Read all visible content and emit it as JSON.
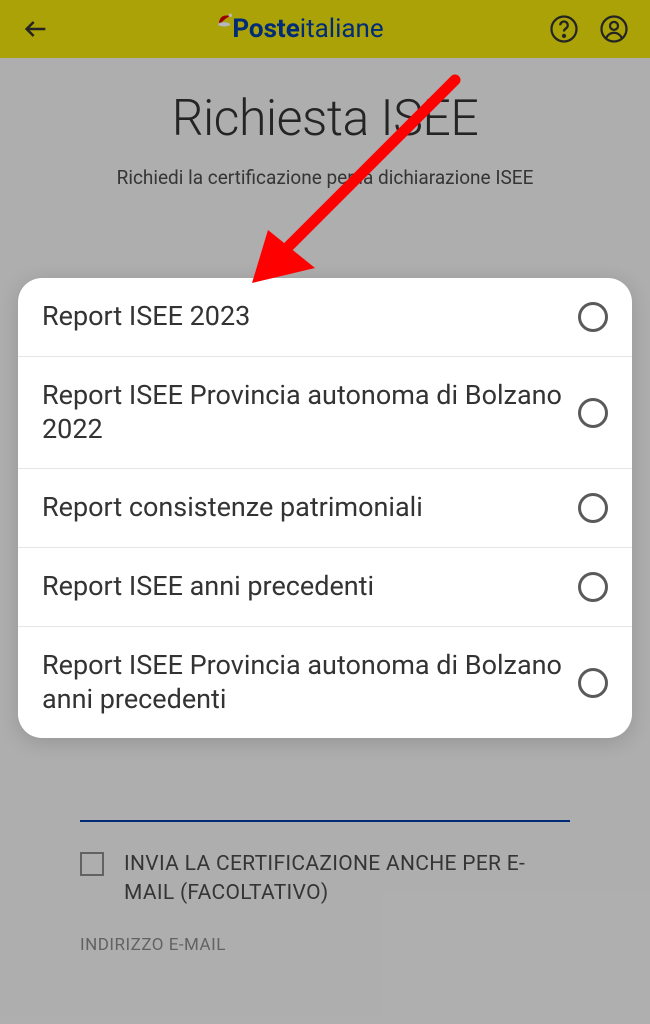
{
  "header": {
    "logo_poste": "Poste",
    "logo_italiane": "italiane"
  },
  "page": {
    "title": "Richiesta ISEE",
    "subtitle": "Richiedi la certificazione per la dichiarazione ISEE"
  },
  "modal": {
    "options": [
      {
        "label": "Report ISEE 2023"
      },
      {
        "label": "Report ISEE Provincia autonoma di Bolzano 2022"
      },
      {
        "label": "Report consistenze patrimoniali"
      },
      {
        "label": "Report ISEE anni precedenti"
      },
      {
        "label": "Report ISEE Provincia autonoma di Bolzano anni precedenti"
      }
    ]
  },
  "form": {
    "checkbox_label": "INVIA LA CERTIFICAZIONE ANCHE PER E-MAIL (FACOLTATIVO)",
    "email_label": "INDIRIZZO E-MAIL"
  },
  "colors": {
    "brand_yellow": "#ece109",
    "brand_blue": "#003da5",
    "arrow_red": "#ff0000"
  }
}
